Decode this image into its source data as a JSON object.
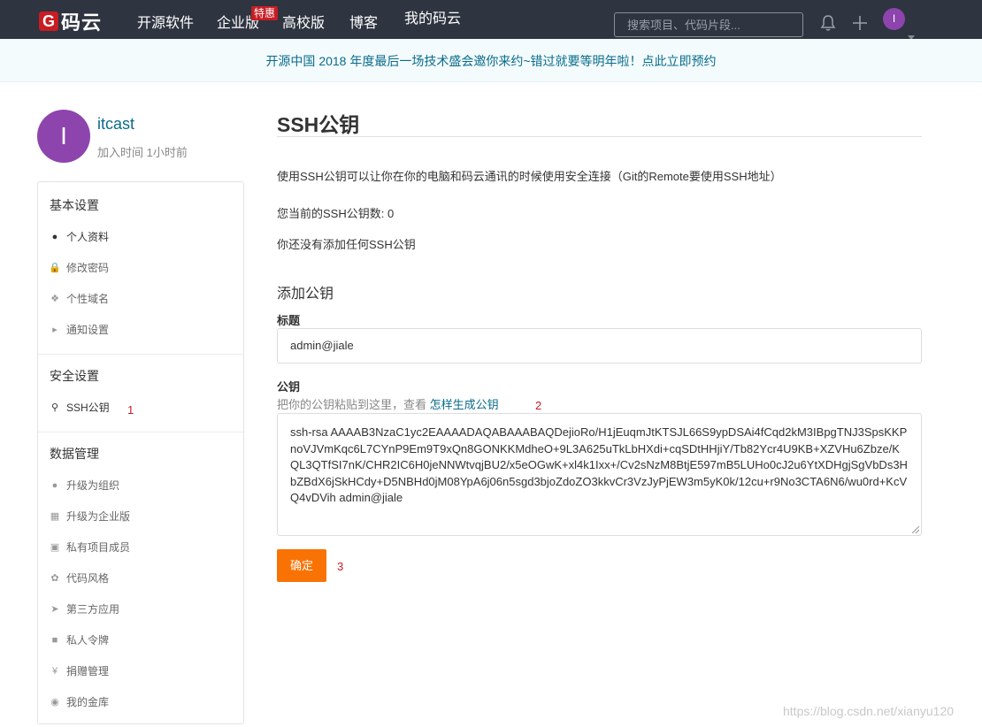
{
  "nav": {
    "logo_text": "码云",
    "logo_letter": "G",
    "items": [
      "开源软件",
      "企业版",
      "高校版",
      "博客",
      "我的码云"
    ],
    "badge": "特惠",
    "search_placeholder": "搜索项目、代码片段...",
    "avatar_letter": "I"
  },
  "banner": {
    "text": "开源中国 2018 年度最后一场技术盛会邀你来约~错过就要等明年啦！点此立即预约"
  },
  "user": {
    "avatar_letter": "I",
    "name": "itcast",
    "joined": "加入时间 1小时前"
  },
  "sidebar": {
    "basic_title": "基本设置",
    "basic_items": [
      "个人资料",
      "修改密码",
      "个性域名",
      "通知设置"
    ],
    "security_title": "安全设置",
    "security_items": [
      "SSH公钥"
    ],
    "data_title": "数据管理",
    "data_items": [
      "升级为组织",
      "升级为企业版",
      "私有项目成员",
      "代码风格",
      "第三方应用",
      "私人令牌",
      "捐赠管理",
      "我的金库"
    ]
  },
  "annotations": {
    "m1": "1",
    "m2": "2",
    "m3": "3"
  },
  "main": {
    "title": "SSH公钥",
    "description": "使用SSH公钥可以让你在你的电脑和码云通讯的时候使用安全连接（Git的Remote要使用SSH地址）",
    "count_text": "您当前的SSH公钥数: 0",
    "empty_text": "你还没有添加任何SSH公钥",
    "add_heading": "添加公钥",
    "title_label": "标题",
    "title_value": "admin@jiale",
    "key_label": "公钥",
    "key_hint": "把你的公钥粘贴到这里，查看",
    "key_hint_link": "怎样生成公钥",
    "key_value": "ssh-rsa AAAAB3NzaC1yc2EAAAADAQABAAABAQDejioRo/H1jEuqmJtKTSJL66S9ypDSAi4fCqd2kM3IBpgTNJ3SpsKKPnoVJVmKqc6L7CYnP9Em9T9xQn8GONKKMdheO+9L3A625uTkLbHXdi+cqSDtHHjiY/Tb82Ycr4U9KB+XZVHu6Zbze/KQL3QTfSI7nK/CHR2IC6H0jeNNWtvqjBU2/x5eOGwK+xl4k1Ixx+/Cv2sNzM8BtjE597mB5LUHo0cJ2u6YtXDHgjSgVbDs3HbZBdX6jSkHCdy+D5NBHd0jM08YpA6j06n5sgd3bjoZdoZO3kkvCr3VzJyPjEW3m5yK0k/12cu+r9No3CTA6N6/wu0rd+KcVQ4vDVih admin@jiale",
    "submit_label": "确定"
  },
  "watermark": "https://blog.csdn.net/xianyu120"
}
